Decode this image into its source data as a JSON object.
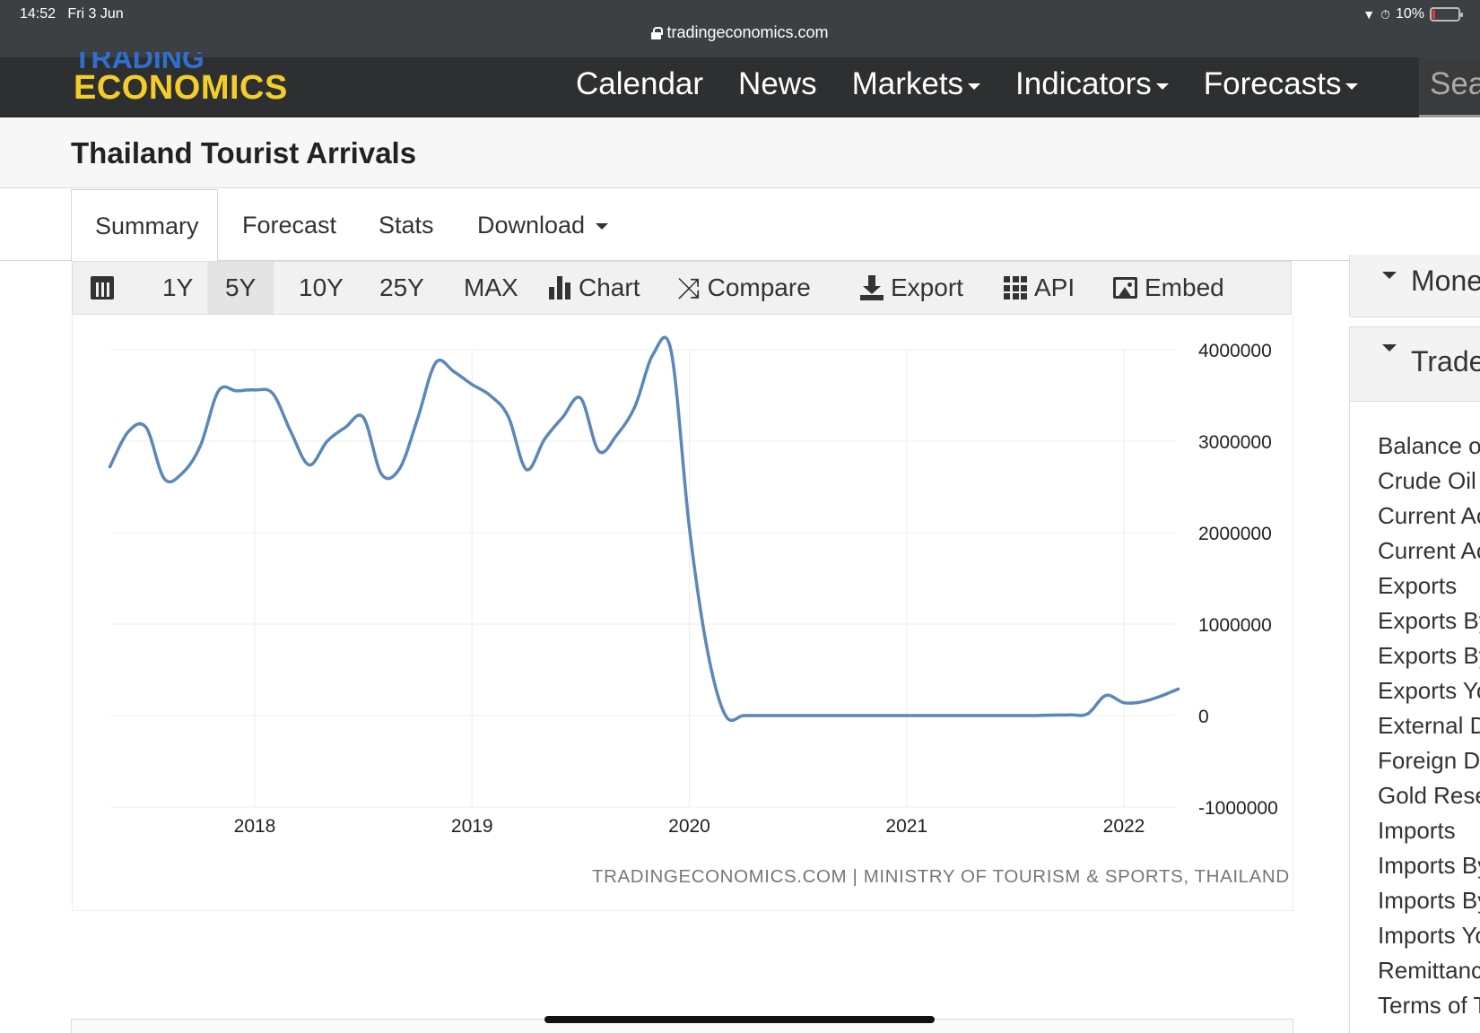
{
  "status": {
    "time": "14:52",
    "date": "Fri 3 Jun",
    "battery": "10%",
    "battery_level": 0.1
  },
  "browser": {
    "url": "tradingeconomics.com"
  },
  "nav": {
    "logo_top": "TRADING",
    "logo_bottom": "ECONOMICS",
    "items": [
      {
        "label": "Calendar",
        "dropdown": false
      },
      {
        "label": "News",
        "dropdown": false
      },
      {
        "label": "Markets",
        "dropdown": true
      },
      {
        "label": "Indicators",
        "dropdown": true
      },
      {
        "label": "Forecasts",
        "dropdown": true
      }
    ],
    "search_placeholder": "Sea"
  },
  "page": {
    "title": "Thailand Tourist Arrivals"
  },
  "tabs": [
    "Summary",
    "Forecast",
    "Stats",
    "Download"
  ],
  "toolbar": {
    "ranges": [
      "1Y",
      "5Y",
      "10Y",
      "25Y",
      "MAX"
    ],
    "selected_range": "5Y",
    "chart": "Chart",
    "compare": "Compare",
    "export": "Export",
    "api": "API",
    "embed": "Embed"
  },
  "chart_data": {
    "type": "line",
    "title": "",
    "xlabel": "",
    "ylabel": "",
    "x_ticks": [
      "2018",
      "2019",
      "2020",
      "2021",
      "2022"
    ],
    "y_ticks": [
      "4000000",
      "3000000",
      "2000000",
      "1000000",
      "0",
      "-1000000"
    ],
    "ylim": [
      -1000000,
      4000000
    ],
    "grid": true,
    "color": "#5b87b9",
    "source": "TRADINGECONOMICS.COM | MINISTRY OF TOURISM & SPORTS, THAILAND",
    "series": [
      {
        "x": [
          "2017-05",
          "2017-06",
          "2017-07",
          "2017-08",
          "2017-09",
          "2017-10",
          "2017-11",
          "2017-12",
          "2018-01",
          "2018-02",
          "2018-03",
          "2018-04",
          "2018-05",
          "2018-06",
          "2018-07",
          "2018-08",
          "2018-09",
          "2018-10",
          "2018-11",
          "2018-12",
          "2019-01",
          "2019-02",
          "2019-03",
          "2019-04",
          "2019-05",
          "2019-06",
          "2019-07",
          "2019-08",
          "2019-09",
          "2019-10",
          "2019-11",
          "2019-12",
          "2020-01",
          "2020-02",
          "2020-03",
          "2020-04",
          "2020-05",
          "2020-06",
          "2020-07",
          "2020-08",
          "2020-09",
          "2020-10",
          "2020-11",
          "2020-12",
          "2021-01",
          "2021-02",
          "2021-03",
          "2021-04",
          "2021-05",
          "2021-06",
          "2021-07",
          "2021-08",
          "2021-09",
          "2021-10",
          "2021-11",
          "2021-12",
          "2022-01",
          "2022-02",
          "2022-03",
          "2022-04"
        ],
        "values": [
          2720000,
          3100000,
          3150000,
          2590000,
          2650000,
          2950000,
          3550000,
          3550000,
          3560000,
          3520000,
          3100000,
          2740000,
          3000000,
          3150000,
          3260000,
          2640000,
          2700000,
          3250000,
          3860000,
          3760000,
          3620000,
          3500000,
          3270000,
          2690000,
          3020000,
          3260000,
          3470000,
          2890000,
          3070000,
          3380000,
          3950000,
          3980000,
          2060000,
          710000,
          0,
          0,
          0,
          0,
          0,
          0,
          0,
          0,
          0,
          0,
          0,
          0,
          0,
          0,
          0,
          0,
          0,
          0,
          5000,
          8000,
          20000,
          220000,
          140000,
          150000,
          210000,
          290000
        ]
      }
    ]
  },
  "sidebar": {
    "sections": [
      "Money",
      "Trade"
    ],
    "links": [
      "Balance of Trade",
      "Crude Oil Production",
      "Current Account",
      "Current Account to GDP",
      "Exports",
      "Exports By Category",
      "Exports By Country",
      "Exports YoY",
      "External Debt",
      "Foreign Direct Investment",
      "Gold Reserves",
      "Imports",
      "Imports By Category",
      "Imports By Country",
      "Imports YoY",
      "Remittances",
      "Terms of Trade"
    ]
  }
}
